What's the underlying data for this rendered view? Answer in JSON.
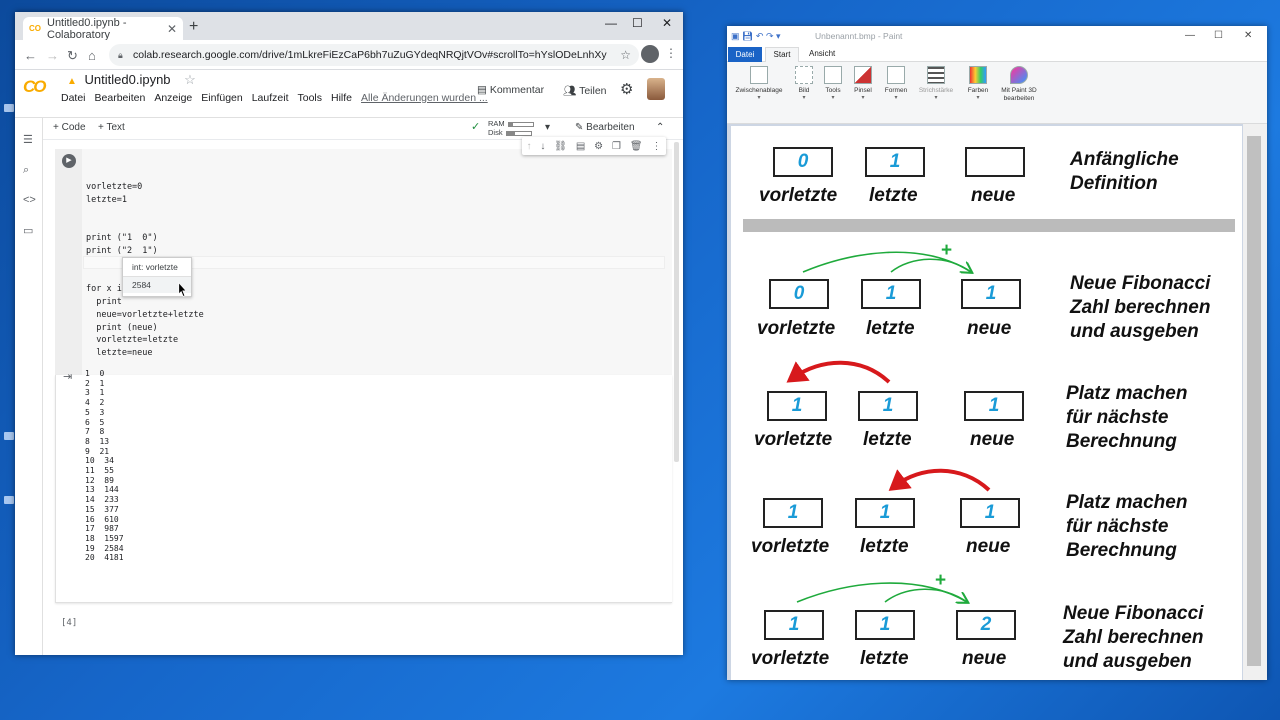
{
  "chrome": {
    "tab_title": "Untitled0.ipynb - Colaboratory",
    "url": "colab.research.google.com/drive/1mLkreFiEzCaP6bh7uZuGYdeqNRQjtVOv#scrollTo=hYslODeLnhXy"
  },
  "colab": {
    "logo": "CO",
    "file_name": "Untitled0.ipynb",
    "menu": [
      "Datei",
      "Bearbeiten",
      "Anzeige",
      "Einfügen",
      "Laufzeit",
      "Tools",
      "Hilfe"
    ],
    "save_status": "Alle Änderungen wurden ...",
    "comment_label": "Kommentar",
    "share_label": "Teilen",
    "add_code": "+ Code",
    "add_text": "+ Text",
    "ram_label": "RAM",
    "disk_label": "Disk",
    "ram_usage": 0.2,
    "disk_usage": 0.35,
    "edit_label": "Bearbeiten",
    "code": "\nvorletzte=0\nletzte=1\n\n\nprint (\"1  0\")\nprint (\"2  1\")\n\n\nfor x i            :\n  print\n  neue=vorletzte+letzte\n  print (neue)\n  vorletzte=letzte\n  letzte=neue",
    "tooltip_type": "int: vorletzte",
    "tooltip_value": "2584",
    "output": "1  0\n2  1\n3  1\n4  2\n5  3\n6  5\n7  8\n8  13\n9  21\n10  34\n11  55\n12  89\n13  144\n14  233\n15  377\n16  610\n17  987\n18  1597\n19  2584\n20  4181",
    "next_cell_label": "[4]"
  },
  "paint": {
    "title": "Unbenannt.bmp - Paint",
    "tabs": {
      "file": "Datei",
      "start": "Start",
      "view": "Ansicht"
    },
    "ribbon": [
      "Zwischenablage",
      "Bild",
      "Tools",
      "Pinsel",
      "Formen",
      "Strichstärke",
      "Farben",
      "Mit Paint 3D bearbeiten"
    ],
    "labels": {
      "vorletzte": "vorletzte",
      "letzte": "letzte",
      "neue": "neue",
      "plus": "+"
    },
    "rows": [
      {
        "values": [
          "0",
          "1",
          ""
        ],
        "desc": "Anfängliche\nDefinition"
      },
      {
        "values": [
          "0",
          "1",
          "1"
        ],
        "desc": "Neue Fibonacci\nZahl berechnen\nund ausgeben"
      },
      {
        "values": [
          "1",
          "1",
          "1"
        ],
        "desc": "Platz machen\nfür nächste\nBerechnung"
      },
      {
        "values": [
          "1",
          "1",
          "1"
        ],
        "desc": "Platz machen\nfür nächste\nBerechnung"
      },
      {
        "values": [
          "1",
          "1",
          "2"
        ],
        "desc": "Neue Fibonacci\nZahl berechnen\nund ausgeben"
      }
    ],
    "colors": {
      "value": "#1a9bd7",
      "green_arrow": "#1faa3c",
      "red_arrow": "#d7191c"
    }
  }
}
